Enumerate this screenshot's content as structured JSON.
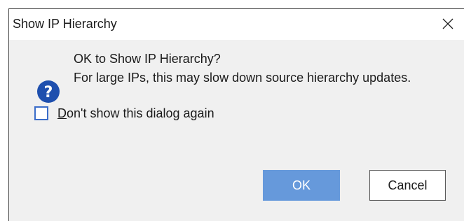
{
  "window": {
    "title": "Show IP Hierarchy",
    "close_icon": "close-icon"
  },
  "message": {
    "icon": "question-icon",
    "icon_color": "#1e4fae",
    "line1": "OK to Show IP Hierarchy?",
    "line2": "For large IPs, this may slow down source hierarchy updates."
  },
  "checkbox": {
    "mnemonic": "D",
    "label_rest": "on't show this dialog again",
    "checked": false
  },
  "buttons": {
    "ok_label": "OK",
    "cancel_label": "Cancel"
  },
  "colors": {
    "ok_button": "#6699db",
    "checkbox_border": "#3b6dc9"
  }
}
